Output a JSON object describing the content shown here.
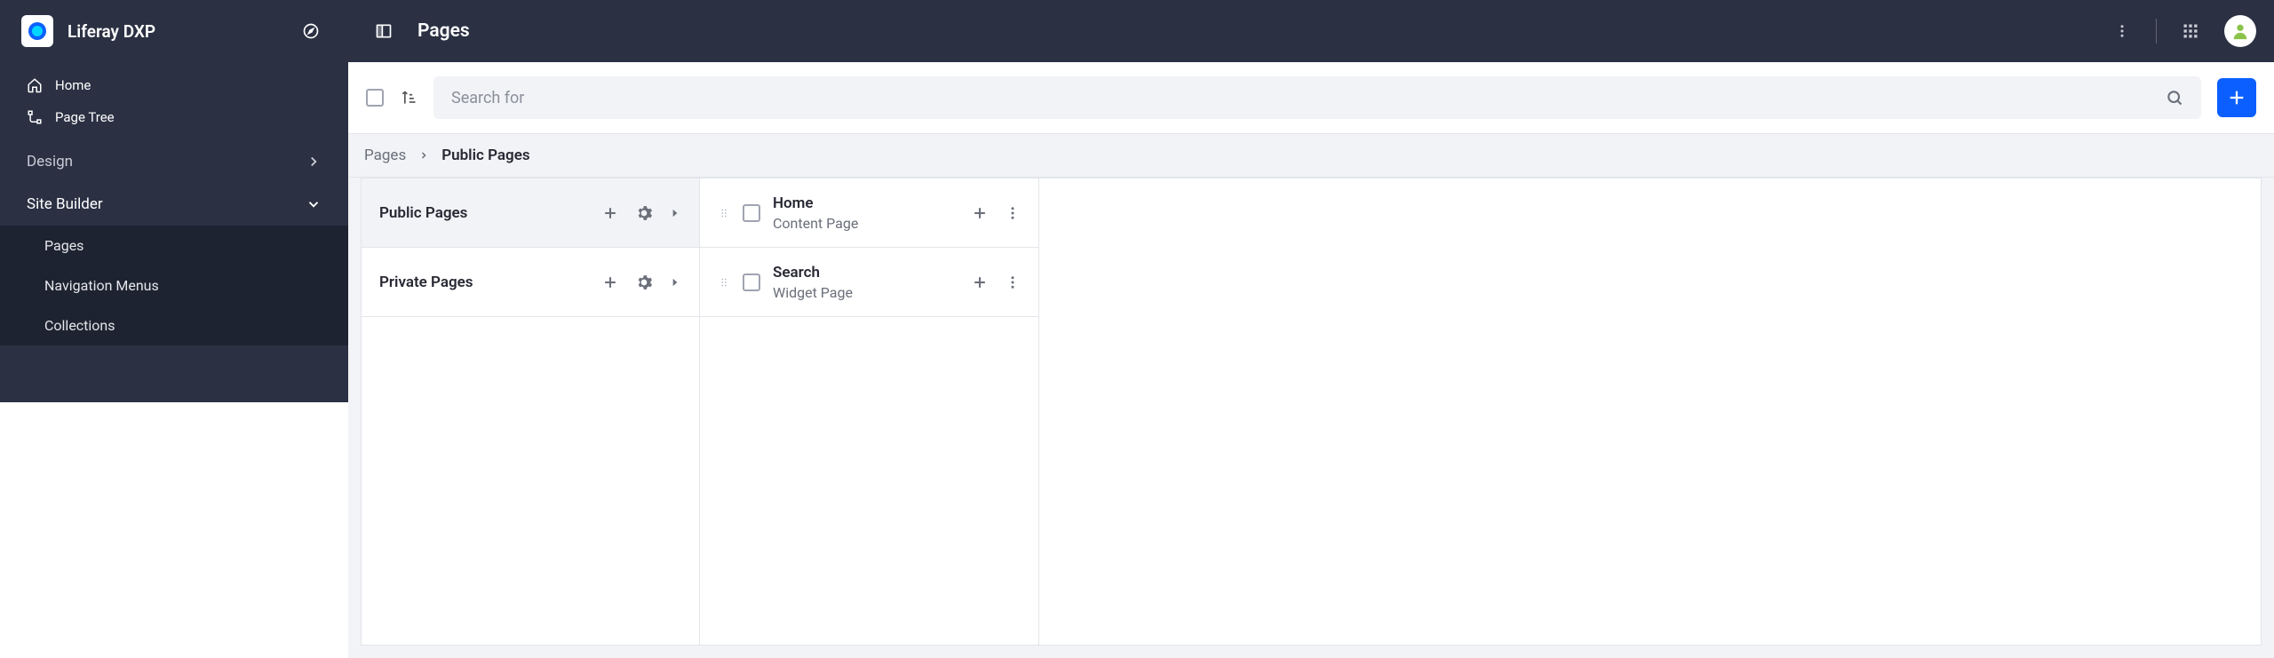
{
  "brand": {
    "name": "Liferay DXP"
  },
  "sidebar": {
    "top": [
      {
        "icon": "home",
        "label": "Home"
      },
      {
        "icon": "tree",
        "label": "Page Tree"
      }
    ],
    "sections": [
      {
        "label": "Design",
        "expanded": false
      },
      {
        "label": "Site Builder",
        "expanded": true,
        "items": [
          {
            "label": "Pages"
          },
          {
            "label": "Navigation Menus"
          },
          {
            "label": "Collections"
          }
        ]
      }
    ]
  },
  "header": {
    "title": "Pages"
  },
  "search": {
    "placeholder": "Search for"
  },
  "breadcrumb": {
    "root": "Pages",
    "current": "Public Pages"
  },
  "groups": [
    {
      "label": "Public Pages",
      "selected": true
    },
    {
      "label": "Private Pages",
      "selected": false
    }
  ],
  "pages": [
    {
      "name": "Home",
      "type": "Content Page"
    },
    {
      "name": "Search",
      "type": "Widget Page"
    }
  ]
}
